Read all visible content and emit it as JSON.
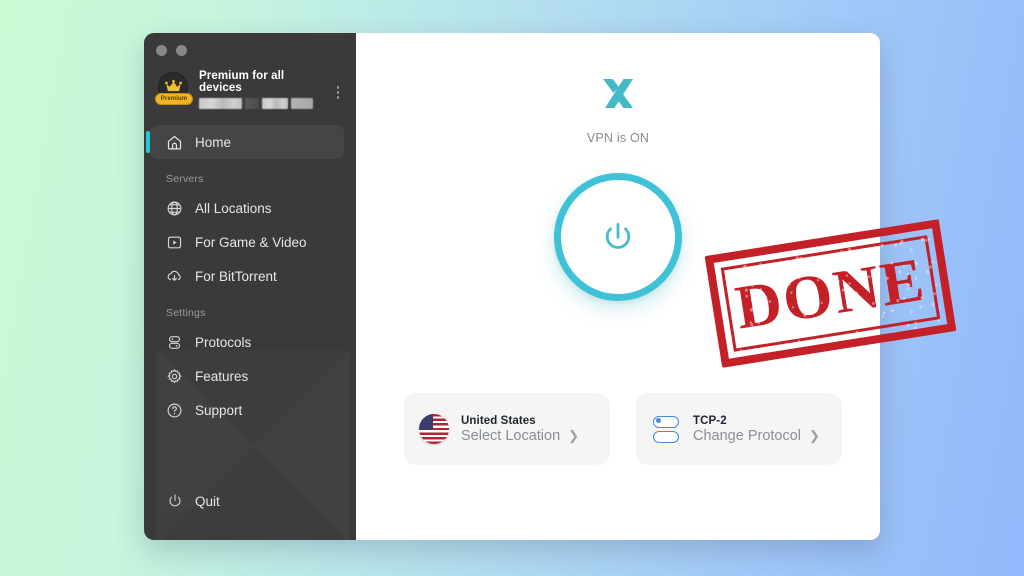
{
  "window": {
    "traffic_lights": [
      "close",
      "minimize"
    ]
  },
  "sidebar": {
    "account": {
      "title": "Premium for all devices",
      "badge_label": "Premium",
      "badge_icon": "crown-icon",
      "redacted": true,
      "menu_icon": "kebab-menu-icon"
    },
    "primary": [
      {
        "label": "Home",
        "icon": "home-icon",
        "active": true
      }
    ],
    "sections": [
      {
        "label": "Servers",
        "items": [
          {
            "label": "All Locations",
            "icon": "globe-icon"
          },
          {
            "label": "For Game & Video",
            "icon": "play-box-icon"
          },
          {
            "label": "For BitTorrent",
            "icon": "download-cloud-icon"
          }
        ]
      },
      {
        "label": "Settings",
        "items": [
          {
            "label": "Protocols",
            "icon": "protocols-icon"
          },
          {
            "label": "Features",
            "icon": "gear-icon"
          },
          {
            "label": "Support",
            "icon": "help-circle-icon"
          }
        ]
      }
    ],
    "quit": {
      "label": "Quit",
      "icon": "power-icon"
    },
    "accent_color": "#22c9de",
    "background_color": "#3a3a3a"
  },
  "main": {
    "logo_icon": "x-vpn-logo",
    "status_text": "VPN is ON",
    "power_button": {
      "icon": "power-icon",
      "state": "on",
      "ring_color": "#3fc2d8"
    },
    "cards": [
      {
        "icon": "us-flag-icon",
        "title": "United States",
        "subtitle": "Select Location",
        "chevron": "chevron-right-icon"
      },
      {
        "icon": "protocol-toggle-icon",
        "title": "TCP-2",
        "subtitle": "Change Protocol",
        "chevron": "chevron-right-icon"
      }
    ]
  },
  "overlay": {
    "stamp_text": "DONE",
    "stamp_color": "#c32027"
  },
  "background": {
    "gradient_from": "#c8fbd4",
    "gradient_to": "#93b8fb"
  }
}
